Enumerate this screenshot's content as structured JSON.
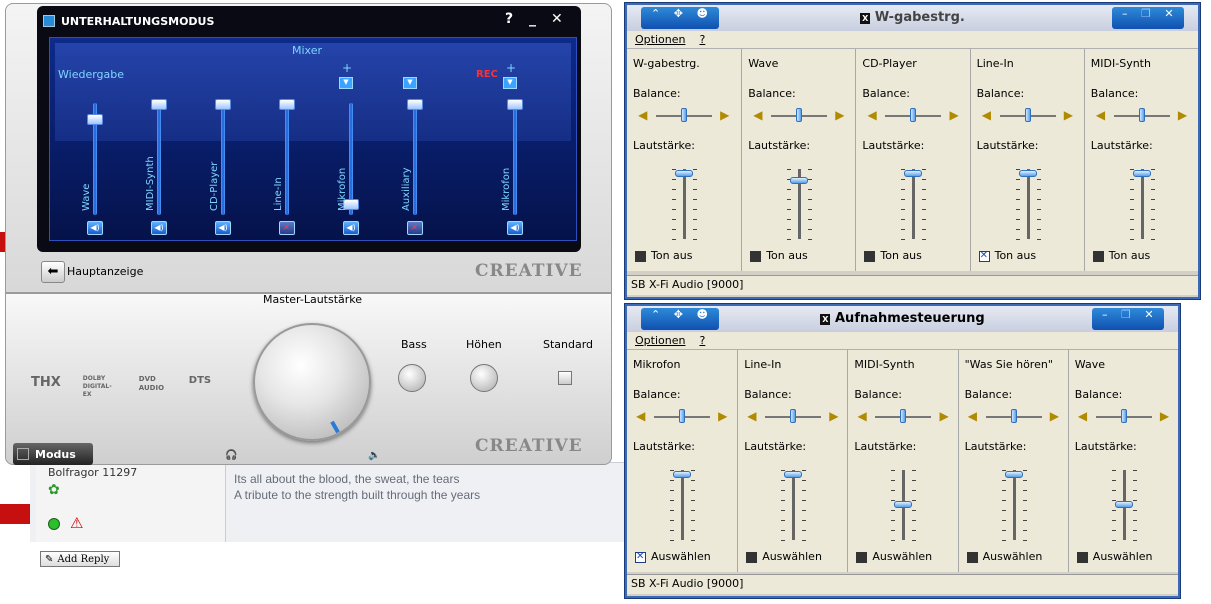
{
  "forum": {
    "post_author": "Bolfragor 11297",
    "quote_line1": "Its all about the blood, the sweat, the tears",
    "quote_line2": "A tribute to the strength built through the years",
    "add_reply": "Add Reply"
  },
  "creative": {
    "title": "UNTERHALTUNGSMODUS",
    "help": "?",
    "minimize": "_",
    "close": "✕",
    "mixer_label": "Mixer",
    "playback_label": "Wiedergabe",
    "rec_label": "REC",
    "channels": [
      {
        "name": "Wave",
        "level": 0.85,
        "muted": false
      },
      {
        "name": "MIDI-Synth",
        "level": 1.0,
        "muted": false
      },
      {
        "name": "CD-Player",
        "level": 1.0,
        "muted": false
      },
      {
        "name": "Line-In",
        "level": 1.0,
        "muted": true
      },
      {
        "name": "Mikrofon",
        "level": 0.0,
        "muted": false
      },
      {
        "name": "Auxiliary",
        "level": 1.0,
        "muted": true
      },
      {
        "name": "Mikrofon",
        "level": 1.0,
        "muted": false
      }
    ],
    "back_label": "Hauptanzeige",
    "brand": "CREATIVE",
    "master_label": "Master-Lautstärke",
    "bass_label": "Bass",
    "treble_label": "Höhen",
    "standard_label": "Standard",
    "logos": [
      "THX",
      "DOLBY DIGITAL-EX",
      "DVD AUDIO",
      "DTS"
    ],
    "modus_label": "Modus"
  },
  "playback_win": {
    "title": "W-gabestrg.",
    "menu": [
      "Optionen",
      "?"
    ],
    "balance_label": "Balance:",
    "volume_label": "Lautstärke:",
    "mute_label": "Ton aus",
    "status": "SB X-Fi Audio [9000]",
    "columns": [
      {
        "name": "W-gabestrg.",
        "level": 0.95,
        "checked": false
      },
      {
        "name": "Wave",
        "level": 0.85,
        "checked": false
      },
      {
        "name": "CD-Player",
        "level": 0.95,
        "checked": false
      },
      {
        "name": "Line-In",
        "level": 0.95,
        "checked": true
      },
      {
        "name": "MIDI-Synth",
        "level": 0.95,
        "checked": false
      }
    ]
  },
  "record_win": {
    "title": "Aufnahmesteuerung",
    "menu": [
      "Optionen",
      "?"
    ],
    "balance_label": "Balance:",
    "volume_label": "Lautstärke:",
    "select_label": "Auswählen",
    "status": "SB X-Fi Audio [9000]",
    "columns": [
      {
        "name": "Mikrofon",
        "level": 0.95,
        "checked": true
      },
      {
        "name": "Line-In",
        "level": 0.95,
        "checked": false
      },
      {
        "name": "MIDI-Synth",
        "level": 0.5,
        "checked": false
      },
      {
        "name": "\"Was Sie hören\"",
        "level": 0.95,
        "checked": false
      },
      {
        "name": "Wave",
        "level": 0.5,
        "checked": false
      }
    ]
  }
}
